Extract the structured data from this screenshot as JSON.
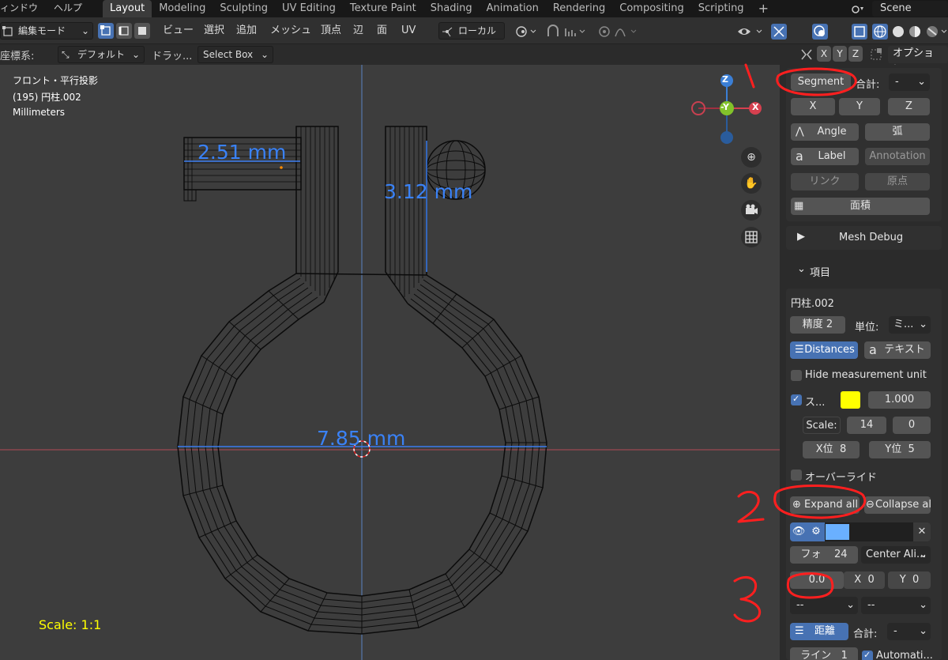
{
  "menu": {
    "window": "ィンドウ",
    "help": "ヘルプ"
  },
  "workspaces": [
    "Layout",
    "Modeling",
    "Sculpting",
    "UV Editing",
    "Texture Paint",
    "Shading",
    "Animation",
    "Rendering",
    "Compositing",
    "Scripting"
  ],
  "add_workspace": "+",
  "scene": "Scene",
  "header": {
    "mode": "編集モード",
    "view": "ビュー",
    "select": "選択",
    "add": "追加",
    "mesh": "メッシュ",
    "vertex": "頂点",
    "edge": "辺",
    "face": "面",
    "uv": "UV",
    "pivot": "ローカル"
  },
  "header2": {
    "coord_label": "座標系:",
    "coord_value": "デフォルト",
    "drag_label": "ドラッ...",
    "select_box": "Select Box",
    "x": "X",
    "y": "Y",
    "z": "Z",
    "options": "オプション"
  },
  "viewport": {
    "view_name": "フロント・平行投影",
    "object": "(195) 円柱.002",
    "units": "Millimeters",
    "dim1": "2.51 mm",
    "dim2": "3.12 mm",
    "dim3": "7.85 mm",
    "scale": "Scale: 1:1",
    "gizmo": {
      "z": "Z",
      "y": "-Y",
      "x": "X"
    }
  },
  "panel": {
    "segment": "Segment",
    "sum_label": "合計:",
    "sum_value": "-",
    "x": "X",
    "y": "Y",
    "z": "Z",
    "angle": "Angle",
    "arc": "弧",
    "label": "Label",
    "annotation": "Annotation",
    "link": "リンク",
    "origin": "原点",
    "area": "面積",
    "mesh_debug": "Mesh Debug",
    "items_header": "項目",
    "obj_name": "円柱.002",
    "precision": "精度 2",
    "unit_label": "単位:",
    "unit_value": "ミ...",
    "distances": "Distances",
    "text": "テキスト",
    "hide_unit": "Hide measurement unit",
    "s_label": "ス...",
    "color_hex": "#ffff00",
    "value_1000": "1.000",
    "scale_label": "Scale:",
    "scale_14": "14",
    "scale_0": "0",
    "xpos": "X位",
    "xpos_val": "8",
    "ypos": "Y位",
    "ypos_val": "5",
    "override": "オーバーライド",
    "expand_all": "Expand all",
    "collapse_all": "Collapse all",
    "font_label": "フォ",
    "font_size": "24",
    "align": "Center Ali...",
    "offset": "0.0",
    "off_x_label": "X",
    "off_x": "0",
    "off_y_label": "Y",
    "off_y": "0",
    "dd1": "--",
    "dd2": "--",
    "distance": "距離",
    "sum2_label": "合計:",
    "sum2_value": "-",
    "line_label": "ライン",
    "line_val": "1",
    "automatic": "Automati..."
  },
  "annotations": [
    "1",
    "2",
    "3"
  ]
}
